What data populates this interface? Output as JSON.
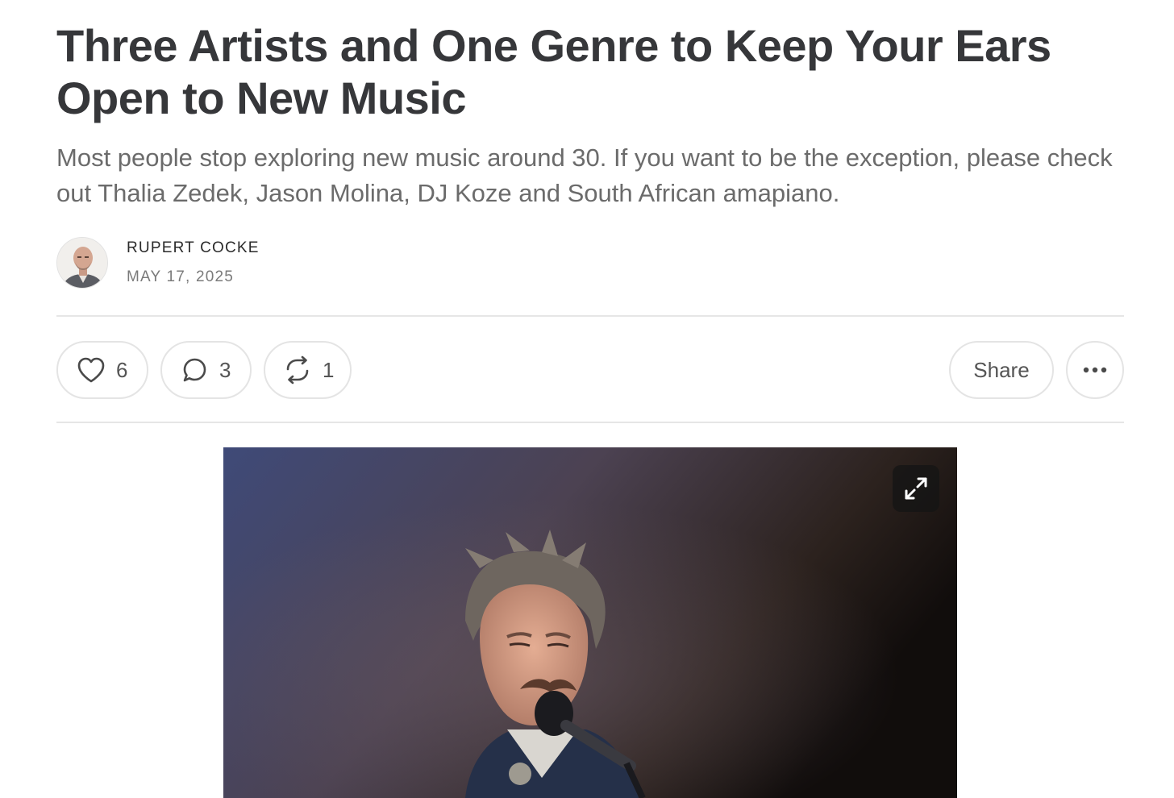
{
  "article": {
    "title": "Three Artists and One Genre to Keep Your Ears Open to New Music",
    "subtitle": "Most people stop exploring new music around 30. If you want to be the exception, please check out Thalia Zedek, Jason Molina, DJ Koze and South African amapiano."
  },
  "author": {
    "name": "RUPERT COCKE",
    "date": "MAY 17, 2025",
    "avatar_icon": "author-avatar"
  },
  "actions": {
    "like_count": "6",
    "comment_count": "3",
    "restack_count": "1",
    "share_label": "Share",
    "like_icon": "heart-icon",
    "comment_icon": "comment-bubble-icon",
    "restack_icon": "restack-icon",
    "more_icon": "ellipsis-icon"
  },
  "hero": {
    "expand_icon": "expand-icon"
  },
  "colors": {
    "title": "#36373a",
    "subtitle": "#6b6b6b",
    "border": "#e4e4e4"
  }
}
